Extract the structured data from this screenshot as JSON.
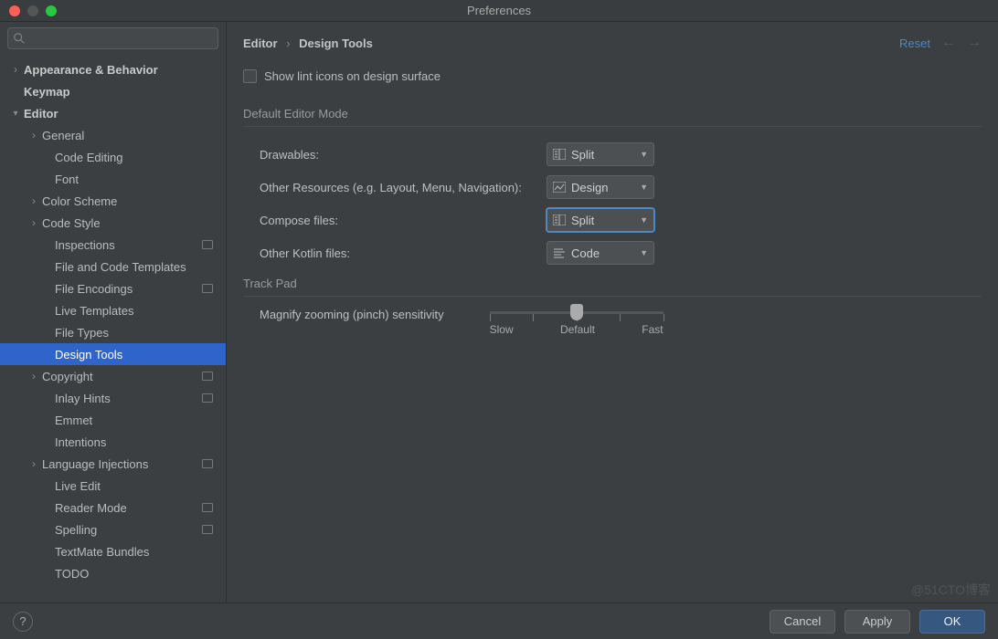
{
  "window": {
    "title": "Preferences"
  },
  "search": {
    "placeholder": ""
  },
  "sidebar": [
    {
      "label": "Appearance & Behavior",
      "depth": 0,
      "arrow": "col",
      "bold": true
    },
    {
      "label": "Keymap",
      "depth": 0,
      "arrow": "",
      "bold": true
    },
    {
      "label": "Editor",
      "depth": 0,
      "arrow": "exp",
      "bold": true
    },
    {
      "label": "General",
      "depth": 1,
      "arrow": "col"
    },
    {
      "label": "Code Editing",
      "depth": 2,
      "arrow": ""
    },
    {
      "label": "Font",
      "depth": 2,
      "arrow": ""
    },
    {
      "label": "Color Scheme",
      "depth": 1,
      "arrow": "col"
    },
    {
      "label": "Code Style",
      "depth": 1,
      "arrow": "col"
    },
    {
      "label": "Inspections",
      "depth": 2,
      "arrow": "",
      "badge": true
    },
    {
      "label": "File and Code Templates",
      "depth": 2,
      "arrow": ""
    },
    {
      "label": "File Encodings",
      "depth": 2,
      "arrow": "",
      "badge": true
    },
    {
      "label": "Live Templates",
      "depth": 2,
      "arrow": ""
    },
    {
      "label": "File Types",
      "depth": 2,
      "arrow": ""
    },
    {
      "label": "Design Tools",
      "depth": 2,
      "arrow": "",
      "selected": true
    },
    {
      "label": "Copyright",
      "depth": 1,
      "arrow": "col",
      "badge": true
    },
    {
      "label": "Inlay Hints",
      "depth": 2,
      "arrow": "",
      "badge": true
    },
    {
      "label": "Emmet",
      "depth": 2,
      "arrow": ""
    },
    {
      "label": "Intentions",
      "depth": 2,
      "arrow": ""
    },
    {
      "label": "Language Injections",
      "depth": 1,
      "arrow": "col",
      "badge": true
    },
    {
      "label": "Live Edit",
      "depth": 2,
      "arrow": ""
    },
    {
      "label": "Reader Mode",
      "depth": 2,
      "arrow": "",
      "badge": true
    },
    {
      "label": "Spelling",
      "depth": 2,
      "arrow": "",
      "badge": true
    },
    {
      "label": "TextMate Bundles",
      "depth": 2,
      "arrow": ""
    },
    {
      "label": "TODO",
      "depth": 2,
      "arrow": ""
    }
  ],
  "breadcrumb": {
    "a": "Editor",
    "b": "Design Tools"
  },
  "reset": "Reset",
  "checkbox": {
    "label": "Show lint icons on design surface"
  },
  "section1": {
    "title": "Default Editor Mode",
    "rows": [
      {
        "label": "Drawables:",
        "value": "Split",
        "icon": "split"
      },
      {
        "label": "Other Resources (e.g. Layout, Menu, Navigation):",
        "value": "Design",
        "icon": "design"
      },
      {
        "label": "Compose files:",
        "value": "Split",
        "icon": "split",
        "focus": true
      },
      {
        "label": "Other Kotlin files:",
        "value": "Code",
        "icon": "code"
      }
    ]
  },
  "section2": {
    "title": "Track Pad",
    "slider_label": "Magnify zooming (pinch) sensitivity",
    "marks": {
      "low": "Slow",
      "mid": "Default",
      "high": "Fast"
    }
  },
  "footer": {
    "cancel": "Cancel",
    "apply": "Apply",
    "ok": "OK"
  },
  "watermark": "@51CTO博客"
}
